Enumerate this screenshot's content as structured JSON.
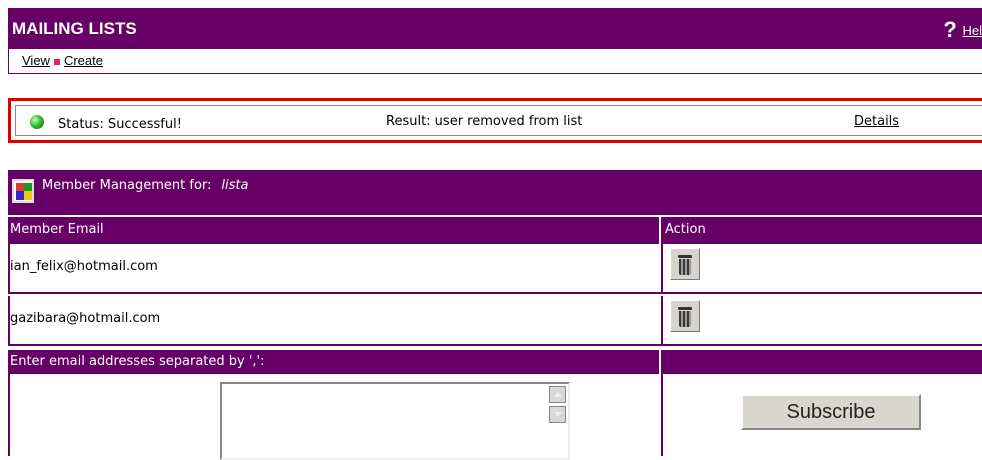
{
  "header": {
    "title": "MAILING LISTS",
    "help_label": "Hel",
    "nav": [
      {
        "label": "View"
      },
      {
        "label": "Create"
      }
    ]
  },
  "status": {
    "status_text": "Status: Successful!",
    "result_text": "Result: user removed from list",
    "details_label": "Details",
    "indicator_color": "#2fbf2f"
  },
  "members": {
    "title_prefix": "Member Management for:",
    "list_name": "lista",
    "columns": {
      "email": "Member Email",
      "action": "Action"
    },
    "rows": [
      {
        "email": "ian_felix@hotmail.com",
        "action_icon": "trash-icon"
      },
      {
        "email": "gazibara@hotmail.com",
        "action_icon": "trash-icon"
      }
    ],
    "enter_label": "Enter email addresses separated by ',':",
    "textarea_value": "",
    "subscribe_label": "Subscribe"
  },
  "colors": {
    "brand": "#660066",
    "alert_border": "#e00000",
    "nav_separator": "#e8255a"
  }
}
